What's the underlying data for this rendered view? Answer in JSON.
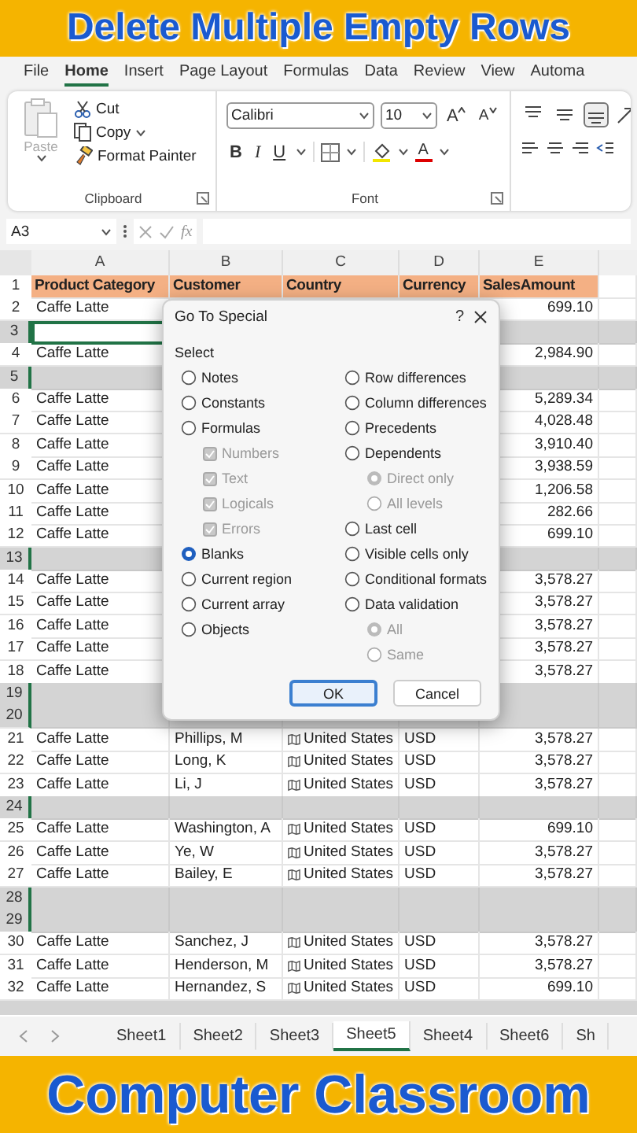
{
  "banner_title": "Delete Multiple Empty Rows",
  "menu": [
    {
      "label": "File",
      "selected": false
    },
    {
      "label": "Home",
      "selected": true
    },
    {
      "label": "Insert",
      "selected": false
    },
    {
      "label": "Page Layout",
      "selected": false
    },
    {
      "label": "Formulas",
      "selected": false
    },
    {
      "label": "Data",
      "selected": false
    },
    {
      "label": "Review",
      "selected": false
    },
    {
      "label": "View",
      "selected": false
    },
    {
      "label": "Automa",
      "selected": false
    }
  ],
  "ribbon": {
    "clipboard": {
      "paste": {
        "label": "Paste",
        "disabled": true
      },
      "cut": "Cut",
      "copy": "Copy",
      "format_painter": "Format Painter",
      "label": "Clipboard"
    },
    "font": {
      "name": "Calibri",
      "size": "10",
      "grow": "A",
      "shrink": "A",
      "styles": [
        "B",
        "I",
        "U"
      ],
      "color_letter": "A",
      "label": "Font"
    },
    "alignment": {
      "vertical": [
        {
          "kind": "top",
          "selected": false
        },
        {
          "kind": "middle",
          "selected": false
        },
        {
          "kind": "bottom",
          "selected": true
        }
      ],
      "horizontal": [
        {
          "kind": "left"
        },
        {
          "kind": "center"
        },
        {
          "kind": "right"
        }
      ]
    }
  },
  "formula_bar": {
    "name_box": "A3",
    "function_label": "fx"
  },
  "columns": [
    "A",
    "B",
    "C",
    "D",
    "E"
  ],
  "header_row": {
    "number": "1",
    "cells": [
      "Product Category",
      "Customer",
      "Country",
      "Currency",
      "SalesAmount"
    ]
  },
  "rows": [
    {
      "number": "2",
      "selected": false,
      "active": false,
      "a": "Caffe Latte",
      "e": "699.10"
    },
    {
      "number": "3",
      "selected": true,
      "active": true
    },
    {
      "number": "4",
      "selected": false,
      "active": false,
      "a": "Caffe Latte",
      "e": "2,984.90"
    },
    {
      "number": "5",
      "selected": true,
      "active": false
    },
    {
      "number": "6",
      "selected": false,
      "active": false,
      "a": "Caffe Latte",
      "e": "5,289.34"
    },
    {
      "number": "7",
      "selected": false,
      "active": false,
      "a": "Caffe Latte",
      "e": "4,028.48"
    },
    {
      "number": "8",
      "selected": false,
      "active": false,
      "a": "Caffe Latte",
      "e": "3,910.40"
    },
    {
      "number": "9",
      "selected": false,
      "active": false,
      "a": "Caffe Latte",
      "e": "3,938.59"
    },
    {
      "number": "10",
      "selected": false,
      "active": false,
      "a": "Caffe Latte",
      "e": "1,206.58"
    },
    {
      "number": "11",
      "selected": false,
      "active": false,
      "a": "Caffe Latte",
      "e": "282.66"
    },
    {
      "number": "12",
      "selected": false,
      "active": false,
      "a": "Caffe Latte",
      "e": "699.10"
    },
    {
      "number": "13",
      "selected": true,
      "active": false
    },
    {
      "number": "14",
      "selected": false,
      "active": false,
      "a": "Caffe Latte",
      "e": "3,578.27"
    },
    {
      "number": "15",
      "selected": false,
      "active": false,
      "a": "Caffe Latte",
      "e": "3,578.27"
    },
    {
      "number": "16",
      "selected": false,
      "active": false,
      "a": "Caffe Latte",
      "e": "3,578.27"
    },
    {
      "number": "17",
      "selected": false,
      "active": false,
      "a": "Caffe Latte",
      "e": "3,578.27"
    },
    {
      "number": "18",
      "selected": false,
      "active": false,
      "a": "Caffe Latte",
      "e": "3,578.27"
    },
    {
      "number": "19",
      "selected": true,
      "active": false
    },
    {
      "number": "20",
      "selected": true,
      "active": false
    },
    {
      "number": "21",
      "selected": false,
      "active": false,
      "a": "Caffe Latte",
      "b": "Phillips, M",
      "c": "United States",
      "d": "USD",
      "e": "3,578.27"
    },
    {
      "number": "22",
      "selected": false,
      "active": false,
      "a": "Caffe Latte",
      "b": "Long, K",
      "c": "United States",
      "d": "USD",
      "e": "3,578.27"
    },
    {
      "number": "23",
      "selected": false,
      "active": false,
      "a": "Caffe Latte",
      "b": "Li, J",
      "c": "United States",
      "d": "USD",
      "e": "3,578.27"
    },
    {
      "number": "24",
      "selected": true,
      "active": false
    },
    {
      "number": "25",
      "selected": false,
      "active": false,
      "a": "Caffe Latte",
      "b": "Washington, A",
      "c": "United States",
      "d": "USD",
      "e": "699.10"
    },
    {
      "number": "26",
      "selected": false,
      "active": false,
      "a": "Caffe Latte",
      "b": "Ye, W",
      "c": "United States",
      "d": "USD",
      "e": "3,578.27"
    },
    {
      "number": "27",
      "selected": false,
      "active": false,
      "a": "Caffe Latte",
      "b": "Bailey, E",
      "c": "United States",
      "d": "USD",
      "e": "3,578.27"
    },
    {
      "number": "28",
      "selected": true,
      "active": false
    },
    {
      "number": "29",
      "selected": true,
      "active": false
    },
    {
      "number": "30",
      "selected": false,
      "active": false,
      "a": "Caffe Latte",
      "b": "Sanchez, J",
      "c": "United States",
      "d": "USD",
      "e": "3,578.27"
    },
    {
      "number": "31",
      "selected": false,
      "active": false,
      "a": "Caffe Latte",
      "b": "Henderson, M",
      "c": "United States",
      "d": "USD",
      "e": "3,578.27"
    },
    {
      "number": "32",
      "selected": false,
      "active": false,
      "a": "Caffe Latte",
      "b": "Hernandez, S",
      "c": "United States",
      "d": "USD",
      "e": "699.10"
    }
  ],
  "dialog": {
    "title": "Go To Special",
    "help": "?",
    "group_label": "Select",
    "left": [
      {
        "label": "Notes",
        "kind": "radio",
        "selected": false,
        "disabled": false
      },
      {
        "label": "Constants",
        "kind": "radio",
        "selected": false,
        "disabled": false
      },
      {
        "label": "Formulas",
        "kind": "radio",
        "selected": false,
        "disabled": false,
        "children": [
          {
            "label": "Numbers",
            "kind": "checkbox",
            "checked": true,
            "disabled": true
          },
          {
            "label": "Text",
            "kind": "checkbox",
            "checked": true,
            "disabled": true
          },
          {
            "label": "Logicals",
            "kind": "checkbox",
            "checked": true,
            "disabled": true
          },
          {
            "label": "Errors",
            "kind": "checkbox",
            "checked": true,
            "disabled": true
          }
        ]
      },
      {
        "label": "Blanks",
        "kind": "radio",
        "selected": true,
        "disabled": false
      },
      {
        "label": "Current region",
        "kind": "radio",
        "selected": false,
        "disabled": false
      },
      {
        "label": "Current array",
        "kind": "radio",
        "selected": false,
        "disabled": false
      },
      {
        "label": "Objects",
        "kind": "radio",
        "selected": false,
        "disabled": false
      }
    ],
    "right": [
      {
        "label": "Row differences",
        "kind": "radio",
        "selected": false,
        "disabled": false
      },
      {
        "label": "Column differences",
        "kind": "radio",
        "selected": false,
        "disabled": false
      },
      {
        "label": "Precedents",
        "kind": "radio",
        "selected": false,
        "disabled": false
      },
      {
        "label": "Dependents",
        "kind": "radio",
        "selected": false,
        "disabled": false,
        "children": [
          {
            "label": "Direct only",
            "kind": "radio",
            "selected": true,
            "disabled": true
          },
          {
            "label": "All levels",
            "kind": "radio",
            "selected": false,
            "disabled": true
          }
        ]
      },
      {
        "label": "Last cell",
        "kind": "radio",
        "selected": false,
        "disabled": false
      },
      {
        "label": "Visible cells only",
        "kind": "radio",
        "selected": false,
        "disabled": false
      },
      {
        "label": "Conditional formats",
        "kind": "radio",
        "selected": false,
        "disabled": false
      },
      {
        "label": "Data validation",
        "kind": "radio",
        "selected": false,
        "disabled": false,
        "children": [
          {
            "label": "All",
            "kind": "radio",
            "selected": true,
            "disabled": true
          },
          {
            "label": "Same",
            "kind": "radio",
            "selected": false,
            "disabled": true
          }
        ]
      }
    ],
    "buttons": [
      {
        "label": "OK",
        "default": true
      },
      {
        "label": "Cancel",
        "default": false
      }
    ]
  },
  "sheet_tabs": [
    {
      "label": "Sheet1",
      "selected": false
    },
    {
      "label": "Sheet2",
      "selected": false
    },
    {
      "label": "Sheet3",
      "selected": false
    },
    {
      "label": "Sheet5",
      "selected": true
    },
    {
      "label": "Sheet4",
      "selected": false
    },
    {
      "label": "Sheet6",
      "selected": false
    },
    {
      "label": "Sh",
      "selected": false
    }
  ],
  "footer_title": "Computer Classroom"
}
